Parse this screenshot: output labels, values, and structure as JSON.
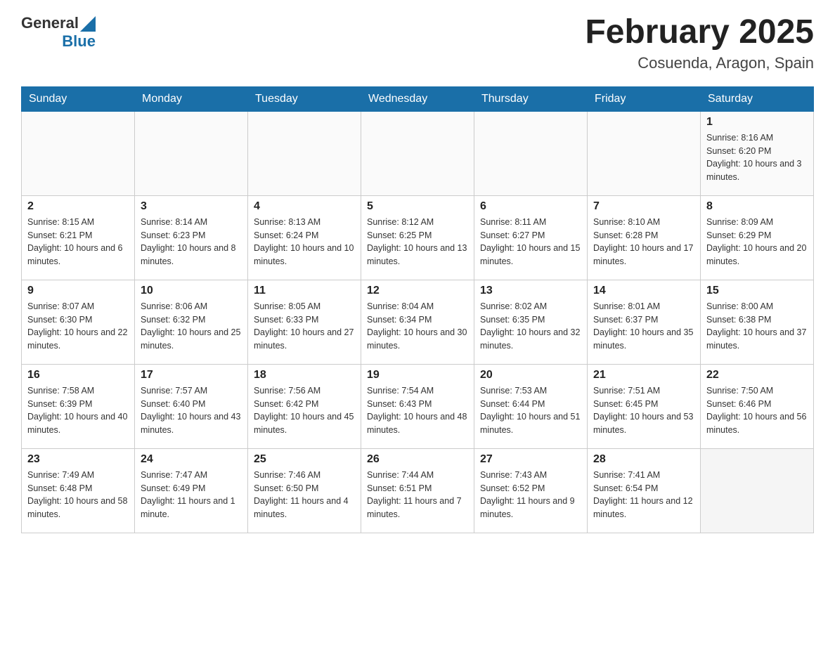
{
  "logo": {
    "general": "General",
    "blue": "Blue"
  },
  "header": {
    "title": "February 2025",
    "subtitle": "Cosuenda, Aragon, Spain"
  },
  "weekdays": [
    "Sunday",
    "Monday",
    "Tuesday",
    "Wednesday",
    "Thursday",
    "Friday",
    "Saturday"
  ],
  "weeks": [
    [
      {
        "day": "",
        "info": ""
      },
      {
        "day": "",
        "info": ""
      },
      {
        "day": "",
        "info": ""
      },
      {
        "day": "",
        "info": ""
      },
      {
        "day": "",
        "info": ""
      },
      {
        "day": "",
        "info": ""
      },
      {
        "day": "1",
        "info": "Sunrise: 8:16 AM\nSunset: 6:20 PM\nDaylight: 10 hours and 3 minutes."
      }
    ],
    [
      {
        "day": "2",
        "info": "Sunrise: 8:15 AM\nSunset: 6:21 PM\nDaylight: 10 hours and 6 minutes."
      },
      {
        "day": "3",
        "info": "Sunrise: 8:14 AM\nSunset: 6:23 PM\nDaylight: 10 hours and 8 minutes."
      },
      {
        "day": "4",
        "info": "Sunrise: 8:13 AM\nSunset: 6:24 PM\nDaylight: 10 hours and 10 minutes."
      },
      {
        "day": "5",
        "info": "Sunrise: 8:12 AM\nSunset: 6:25 PM\nDaylight: 10 hours and 13 minutes."
      },
      {
        "day": "6",
        "info": "Sunrise: 8:11 AM\nSunset: 6:27 PM\nDaylight: 10 hours and 15 minutes."
      },
      {
        "day": "7",
        "info": "Sunrise: 8:10 AM\nSunset: 6:28 PM\nDaylight: 10 hours and 17 minutes."
      },
      {
        "day": "8",
        "info": "Sunrise: 8:09 AM\nSunset: 6:29 PM\nDaylight: 10 hours and 20 minutes."
      }
    ],
    [
      {
        "day": "9",
        "info": "Sunrise: 8:07 AM\nSunset: 6:30 PM\nDaylight: 10 hours and 22 minutes."
      },
      {
        "day": "10",
        "info": "Sunrise: 8:06 AM\nSunset: 6:32 PM\nDaylight: 10 hours and 25 minutes."
      },
      {
        "day": "11",
        "info": "Sunrise: 8:05 AM\nSunset: 6:33 PM\nDaylight: 10 hours and 27 minutes."
      },
      {
        "day": "12",
        "info": "Sunrise: 8:04 AM\nSunset: 6:34 PM\nDaylight: 10 hours and 30 minutes."
      },
      {
        "day": "13",
        "info": "Sunrise: 8:02 AM\nSunset: 6:35 PM\nDaylight: 10 hours and 32 minutes."
      },
      {
        "day": "14",
        "info": "Sunrise: 8:01 AM\nSunset: 6:37 PM\nDaylight: 10 hours and 35 minutes."
      },
      {
        "day": "15",
        "info": "Sunrise: 8:00 AM\nSunset: 6:38 PM\nDaylight: 10 hours and 37 minutes."
      }
    ],
    [
      {
        "day": "16",
        "info": "Sunrise: 7:58 AM\nSunset: 6:39 PM\nDaylight: 10 hours and 40 minutes."
      },
      {
        "day": "17",
        "info": "Sunrise: 7:57 AM\nSunset: 6:40 PM\nDaylight: 10 hours and 43 minutes."
      },
      {
        "day": "18",
        "info": "Sunrise: 7:56 AM\nSunset: 6:42 PM\nDaylight: 10 hours and 45 minutes."
      },
      {
        "day": "19",
        "info": "Sunrise: 7:54 AM\nSunset: 6:43 PM\nDaylight: 10 hours and 48 minutes."
      },
      {
        "day": "20",
        "info": "Sunrise: 7:53 AM\nSunset: 6:44 PM\nDaylight: 10 hours and 51 minutes."
      },
      {
        "day": "21",
        "info": "Sunrise: 7:51 AM\nSunset: 6:45 PM\nDaylight: 10 hours and 53 minutes."
      },
      {
        "day": "22",
        "info": "Sunrise: 7:50 AM\nSunset: 6:46 PM\nDaylight: 10 hours and 56 minutes."
      }
    ],
    [
      {
        "day": "23",
        "info": "Sunrise: 7:49 AM\nSunset: 6:48 PM\nDaylight: 10 hours and 58 minutes."
      },
      {
        "day": "24",
        "info": "Sunrise: 7:47 AM\nSunset: 6:49 PM\nDaylight: 11 hours and 1 minute."
      },
      {
        "day": "25",
        "info": "Sunrise: 7:46 AM\nSunset: 6:50 PM\nDaylight: 11 hours and 4 minutes."
      },
      {
        "day": "26",
        "info": "Sunrise: 7:44 AM\nSunset: 6:51 PM\nDaylight: 11 hours and 7 minutes."
      },
      {
        "day": "27",
        "info": "Sunrise: 7:43 AM\nSunset: 6:52 PM\nDaylight: 11 hours and 9 minutes."
      },
      {
        "day": "28",
        "info": "Sunrise: 7:41 AM\nSunset: 6:54 PM\nDaylight: 11 hours and 12 minutes."
      },
      {
        "day": "",
        "info": ""
      }
    ]
  ]
}
